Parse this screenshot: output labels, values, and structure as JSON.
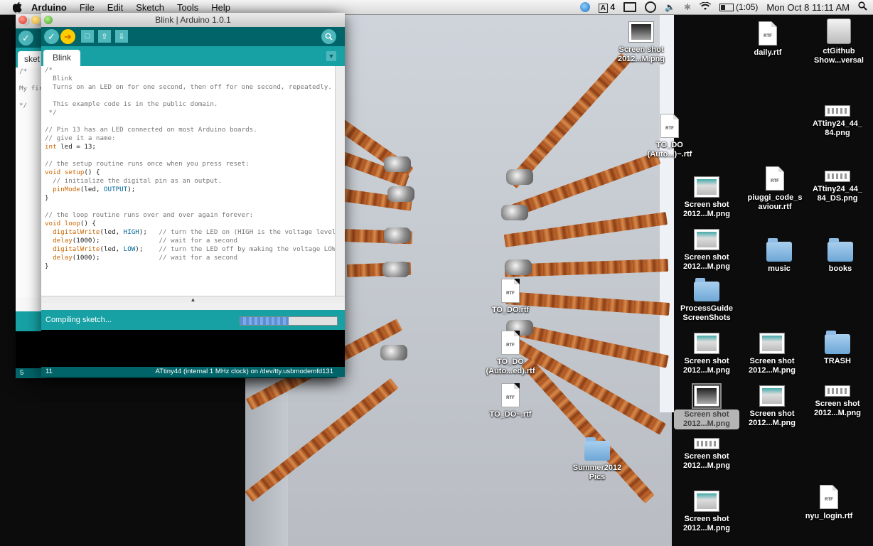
{
  "menubar": {
    "app_name": "Arduino",
    "menus": [
      "File",
      "Edit",
      "Sketch",
      "Tools",
      "Help"
    ],
    "status_items": {
      "adobe": "4",
      "battery_time": "(1:05)",
      "clock": "Mon Oct 8  11:11 AM"
    }
  },
  "arduino_back": {
    "tab": "sket",
    "code_lines": [
      "/*",
      "",
      "My fir",
      "",
      "*/"
    ],
    "line_number": "5"
  },
  "arduino": {
    "window_title": "Blink | Arduino 1.0.1",
    "tab": "Blink",
    "status_message": "Compiling sketch...",
    "progress_percent": 50,
    "line_number": "11",
    "board_info": "ATtiny44 (internal 1 MHz clock) on /dev/tty.usbmodemfd131",
    "code_lines": [
      "/*",
      "  Blink",
      "  Turns on an LED on for one second, then off for one second, repeatedly.",
      "",
      "  This example code is in the public domain.",
      " */",
      "",
      "// Pin 13 has an LED connected on most Arduino boards.",
      "// give it a name:",
      "int led = 13;",
      "",
      "// the setup routine runs once when you press reset:",
      "void setup() {",
      "  // initialize the digital pin as an output.",
      "  pinMode(led, OUTPUT);",
      "}",
      "",
      "// the loop routine runs over and over again forever:",
      "void loop() {",
      "  digitalWrite(led, HIGH);   // turn the LED on (HIGH is the voltage level)",
      "  delay(1000);               // wait for a second",
      "  digitalWrite(led, LOW);    // turn the LED off by making the voltage LOW",
      "  delay(1000);               // wait for a second",
      "}"
    ]
  },
  "desktop_icons": {
    "screenshot_top": "Screen shot\n2012...M.png",
    "todo_auto1": "TO_DO\n(Auto...)~.rtf",
    "todo": "TO_DO.rtf",
    "todo_auto2": "TO_DO\n(Auto...ed).rtf",
    "todo_tilde": "TO_DO~.rtf",
    "summer": "Summer2012\nPics",
    "ss1": "Screen shot\n2012...M.png",
    "ss2": "Screen shot\n2012...M.png",
    "process": "ProcessGuide\nScreenShots",
    "ss3": "Screen shot\n2012...M.png",
    "ss4": "Screen shot\n2012...M.png",
    "ss5": "Screen shot\n2012...M.png",
    "ss6": "Screen shot\n2012...M.png",
    "daily": "daily.rtf",
    "piuggi": "piuggi_code_s\naviour.rtf",
    "music": "music",
    "ss7": "Screen shot\n2012...M.png",
    "ss8": "Screen shot\n2012...M.png",
    "disk": "ctGithub\nShow...versal",
    "attiny1": "ATtiny24_44_\n84.png",
    "attiny2": "ATtiny24_44_\n84_DS.png",
    "books": "books",
    "trash": "TRASH",
    "ss9": "Screen shot\n2012...M.png",
    "nyu": "nyu_login.rtf",
    "doc_label": "RTF"
  }
}
